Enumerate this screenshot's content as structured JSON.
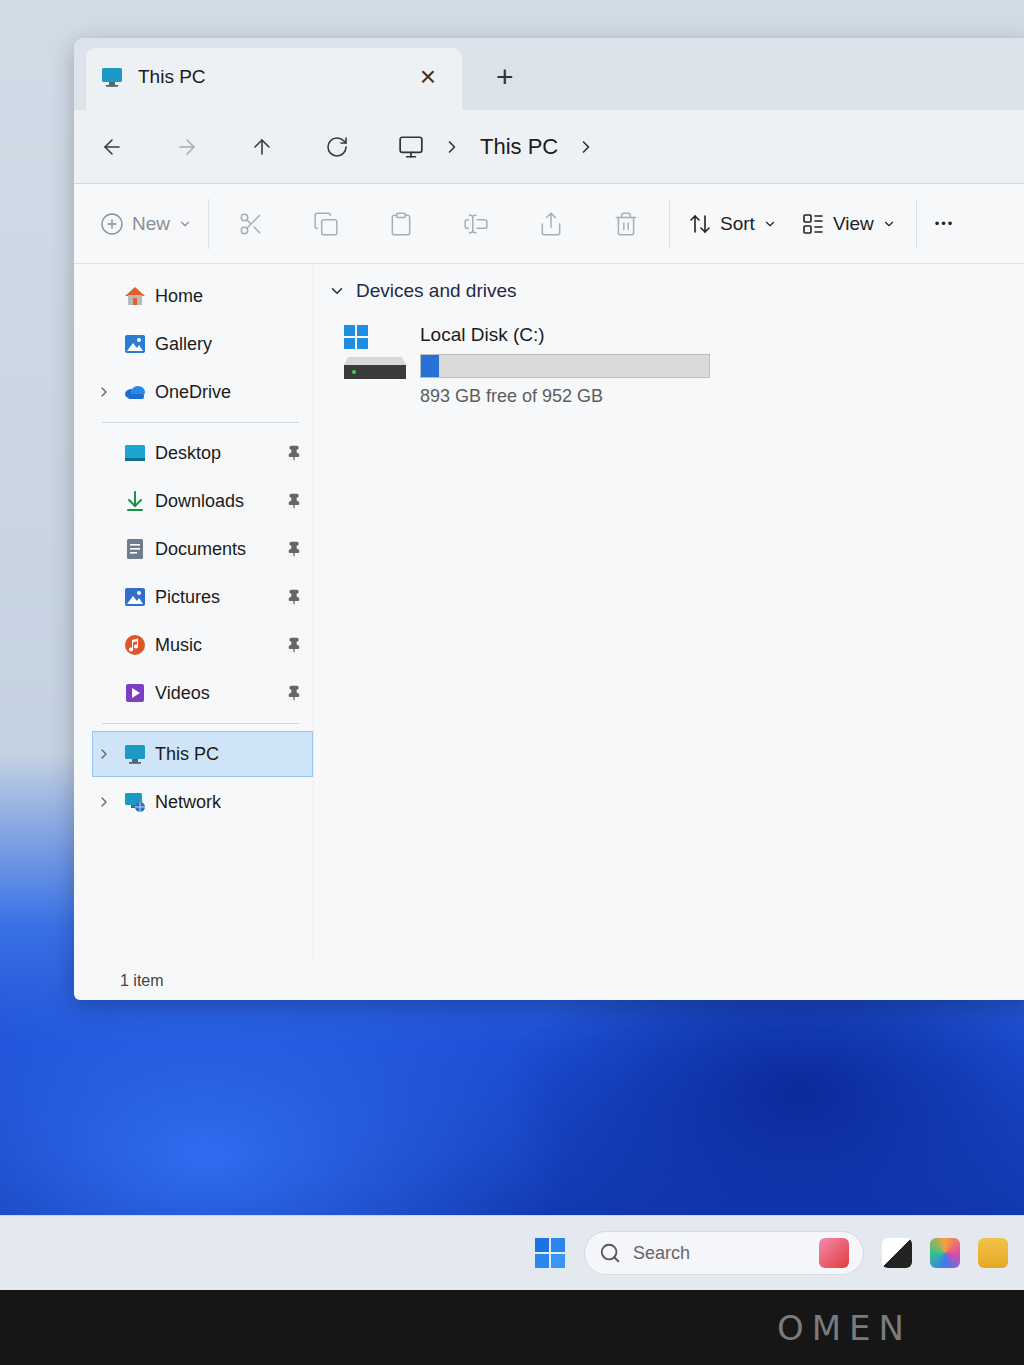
{
  "window": {
    "title": "This PC",
    "close": "×",
    "new_tab": "+"
  },
  "nav_buttons": [
    {
      "disabled": false
    },
    {
      "disabled": true
    },
    {
      "disabled": false
    },
    {
      "disabled": false
    }
  ],
  "address_bar": {
    "path": [
      "This PC"
    ]
  },
  "command_bar": {
    "new": "New",
    "actions": [
      {
        "disabled": true
      },
      {
        "disabled": true
      },
      {
        "disabled": true
      },
      {
        "disabled": true
      },
      {
        "disabled": true
      },
      {
        "disabled": true
      }
    ],
    "sort": "Sort",
    "view": "View",
    "more": "•••"
  },
  "sidebar": {
    "sections": [
      [
        {
          "label": "Home",
          "expandable": false,
          "expanded": false,
          "pinned": false,
          "selected": false
        },
        {
          "label": "Gallery",
          "expandable": false,
          "expanded": false,
          "pinned": false,
          "selected": false
        },
        {
          "label": "OneDrive",
          "expandable": true,
          "expanded": false,
          "pinned": false,
          "selected": false
        }
      ],
      [
        {
          "label": "Desktop",
          "expandable": false,
          "expanded": false,
          "pinned": true,
          "selected": false
        },
        {
          "label": "Downloads",
          "expandable": false,
          "expanded": false,
          "pinned": true,
          "selected": false
        },
        {
          "label": "Documents",
          "expandable": false,
          "expanded": false,
          "pinned": true,
          "selected": false
        },
        {
          "label": "Pictures",
          "expandable": false,
          "expanded": false,
          "pinned": true,
          "selected": false
        },
        {
          "label": "Music",
          "expandable": false,
          "expanded": false,
          "pinned": true,
          "selected": false
        },
        {
          "label": "Videos",
          "expandable": false,
          "expanded": false,
          "pinned": true,
          "selected": false
        }
      ],
      [
        {
          "label": "This PC",
          "expandable": true,
          "expanded": false,
          "pinned": false,
          "selected": true
        },
        {
          "label": "Network",
          "expandable": true,
          "expanded": false,
          "pinned": false,
          "selected": false
        }
      ]
    ]
  },
  "content": {
    "groups": [
      {
        "label": "Devices and drives",
        "expanded": true,
        "drives": [
          {
            "name": "Local Disk (C:)",
            "level": 0.062,
            "space": "893 GB free of 952 GB"
          }
        ]
      }
    ]
  },
  "status_bar": {
    "count": "1 item"
  },
  "taskbar": {
    "search_placeholder": "Search"
  },
  "bezel": {
    "logo": "OMEN"
  }
}
